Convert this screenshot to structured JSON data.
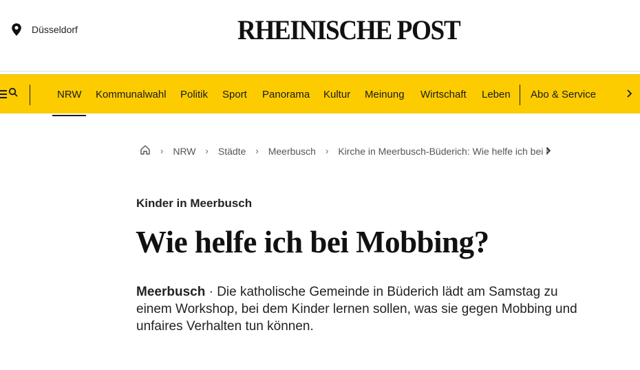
{
  "header": {
    "location": "Düsseldorf",
    "logo": "RHEINISCHE POST"
  },
  "nav": {
    "items": [
      "NRW",
      "Kommunalwahl",
      "Politik",
      "Sport",
      "Panorama",
      "Kultur",
      "Meinung",
      "Wirtschaft",
      "Leben",
      "Abo & Service"
    ],
    "active": "NRW"
  },
  "breadcrumb": {
    "home_icon": "home-icon",
    "items": [
      "NRW",
      "Städte",
      "Meerbusch",
      "Kirche in Meerbusch-Büderich: Wie helfe ich bei Mobbing?"
    ]
  },
  "article": {
    "kicker": "Kinder in Meerbusch",
    "headline": "Wie helfe ich bei Mobbing?",
    "dateline": "Meerbusch",
    "separator": " · ",
    "lead": "Die katholische Gemeinde in Büderich lädt am Samstag zu einem Workshop, bei dem Kinder lernen sollen, was sie gegen Mobbing und unfaires Verhalten tun können."
  },
  "colors": {
    "nav_background": "#fccc00",
    "text": "#111111"
  }
}
